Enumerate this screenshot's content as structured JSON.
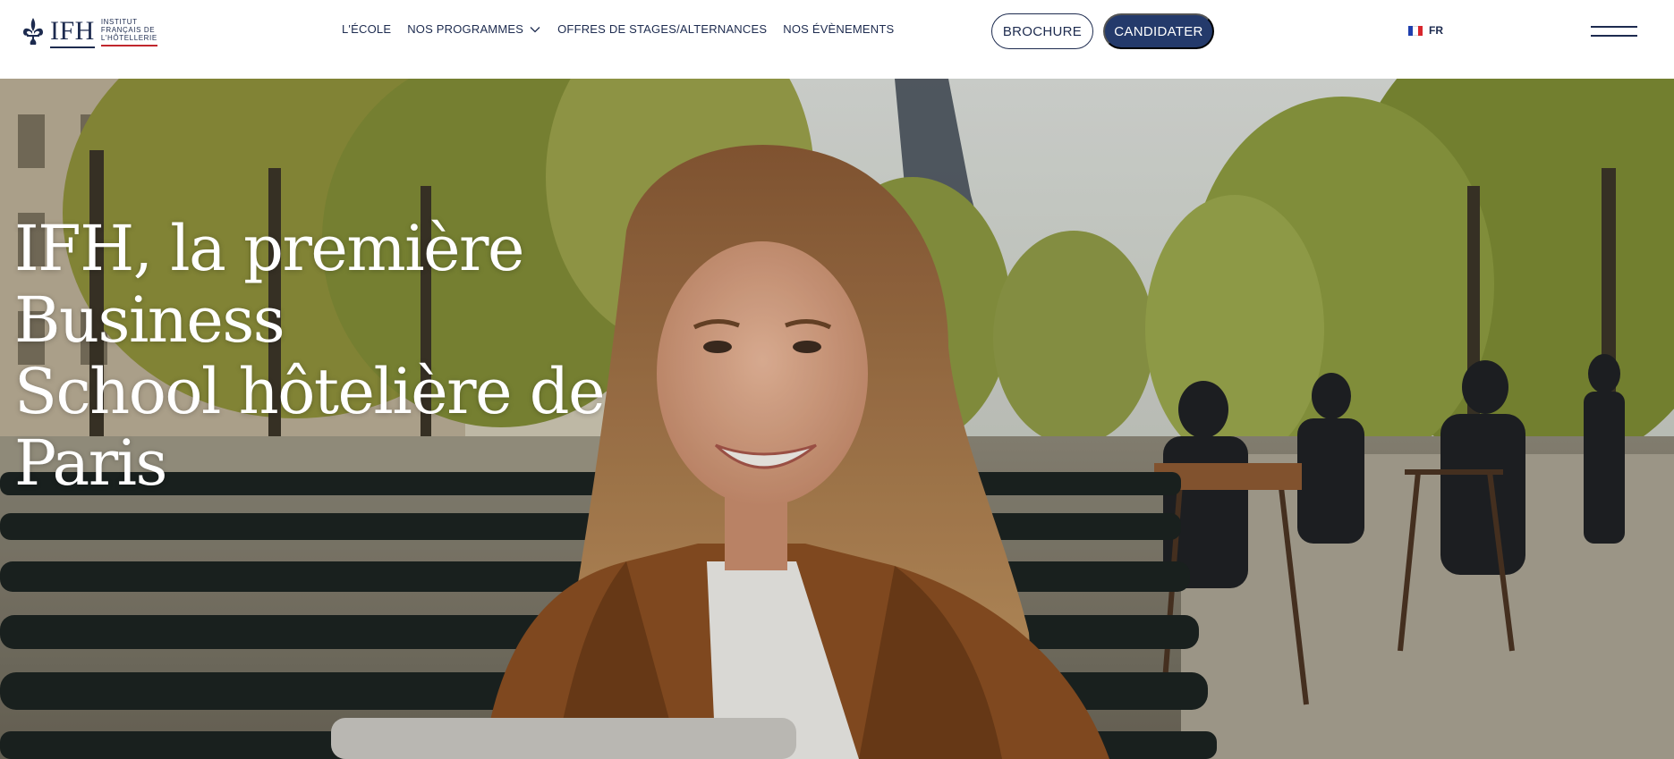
{
  "logo": {
    "wordmark": "IFH",
    "sub_line1": "INSTITUT",
    "sub_line2": "FRANÇAIS DE",
    "sub_line3": "L'HÔTELLERIE",
    "icon": "fleur-de-lis-icon"
  },
  "nav": {
    "items": [
      {
        "label": "L'ÉCOLE"
      },
      {
        "label": "NOS PROGRAMMES",
        "has_dropdown": true
      },
      {
        "label": "OFFRES DE STAGES/ALTERNANCES"
      },
      {
        "label": "NOS ÉVÈNEMENTS"
      }
    ]
  },
  "actions": {
    "brochure_label": "BROCHURE",
    "candidater_label": "CANDIDATER"
  },
  "language": {
    "label": "FR",
    "flag_icon": "france-flag-icon"
  },
  "menu_icon": "hamburger-menu-icon",
  "hero": {
    "title_line1": "IFH, la première Business",
    "title_line2": "School hôtelière de Paris"
  },
  "colors": {
    "brand_navy": "#243a6b",
    "text_navy": "#1d2b4f",
    "accent_red": "#c1272d",
    "flag_blue": "#1f3fae",
    "flag_red": "#d8262d"
  }
}
